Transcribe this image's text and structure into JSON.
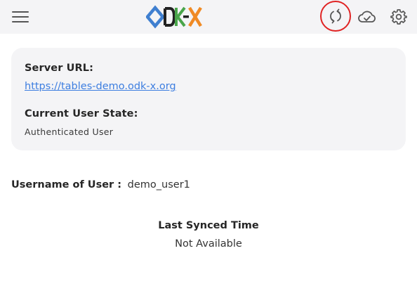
{
  "header": {
    "logo_text": "ODK-X",
    "icons": {
      "menu": "hamburger-menu-icon",
      "sync": "sync-icon",
      "cloud": "cloud-done-icon",
      "settings": "gear-icon"
    },
    "colors": {
      "logo_blue": "#3f7fd0",
      "logo_green": "#49a54a",
      "logo_orange": "#f08a24",
      "sync_highlight": "#e02323"
    }
  },
  "server_card": {
    "server_url_label": "Server URL:",
    "server_url": "https://tables-demo.odk-x.org",
    "user_state_label": "Current User State:",
    "user_state": "Authenticated User"
  },
  "user": {
    "username_label": "Username of User :",
    "username": "demo_user1"
  },
  "sync": {
    "last_synced_label": "Last Synced Time",
    "last_synced_value": "Not Available"
  },
  "colors": {
    "app_bar_bg": "#f4f4f6",
    "card_bg": "#f4f4f6",
    "link": "#3d7ee0"
  }
}
